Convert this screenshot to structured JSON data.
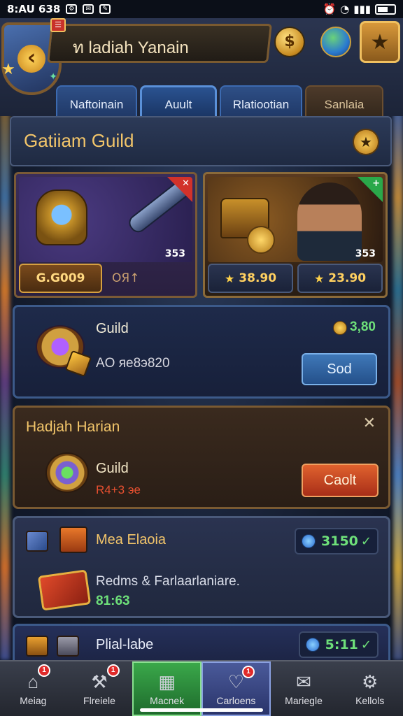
{
  "status": {
    "time": "8:AU 638",
    "icons": [
      "settings-icon",
      "mail-icon",
      "chat-icon"
    ]
  },
  "header": {
    "title": "ท ladiah Yanain",
    "notification_glyph": "☰"
  },
  "tabs": [
    {
      "label": "Naftoinain",
      "active": false
    },
    {
      "label": "Auult",
      "active": true
    },
    {
      "label": "Rlatiootian",
      "active": false
    },
    {
      "label": "Sanlaia",
      "active": false
    }
  ],
  "guild": {
    "title": "Gatiiam Guild"
  },
  "cards": [
    {
      "count": "353",
      "price": "G.G009",
      "secondary": "OЯ↑",
      "tag": "red"
    },
    {
      "count": "353",
      "price1": "38.90",
      "price2": "23.90",
      "tag": "green"
    }
  ],
  "offers": {
    "guild": {
      "name": "Guild",
      "subtitle": "AO яe8э820",
      "amount": "3,80",
      "button": "Sod"
    },
    "daily": {
      "title": "Hadjah Harian",
      "name": "Guild",
      "subtitle": "R4+3 эe",
      "button": "Caolt"
    },
    "mega": {
      "title": "Mea Elaoia",
      "amount": "3150",
      "description": "Redms & Farlaarlaniare.",
      "value": "81:63"
    },
    "pack": {
      "title": "Plial-labe",
      "amount": "5:11"
    }
  },
  "nav": [
    {
      "label": "Meiag",
      "icon": "home-icon",
      "badge": "1"
    },
    {
      "label": "Flreiele",
      "icon": "hammer-icon",
      "badge": "1"
    },
    {
      "label": "Macnek",
      "icon": "grid-icon",
      "badge": ""
    },
    {
      "label": "Carloens",
      "icon": "heart-icon",
      "badge": "1"
    },
    {
      "label": "Mariegle",
      "icon": "letter-icon",
      "badge": ""
    },
    {
      "label": "Kellols",
      "icon": "gear-icon",
      "badge": ""
    }
  ]
}
